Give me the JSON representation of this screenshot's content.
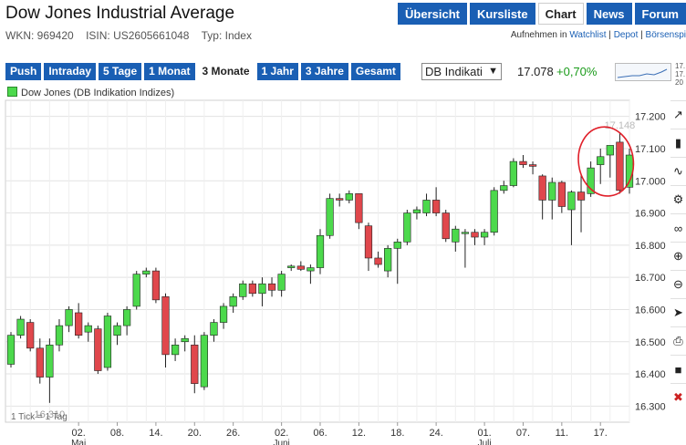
{
  "header": {
    "title": "Dow Jones Industrial Average",
    "wkn": "WKN: 969420",
    "isin": "ISIN: US2605661048",
    "typ": "Typ: Index"
  },
  "nav": {
    "tabs": [
      "Übersicht",
      "Kursliste",
      "Chart",
      "News",
      "Forum"
    ],
    "active": "Chart"
  },
  "links": {
    "prefix": "Aufnehmen in",
    "watchlist": "Watchlist",
    "sep1": " | ",
    "depot": "Depot",
    "sep2": " | ",
    "boersenspiel": "Börsenspi"
  },
  "ranges": {
    "items": [
      "Push",
      "Intraday",
      "5 Tage",
      "1 Monat",
      "3 Monate",
      "1 Jahr",
      "3 Jahre",
      "Gesamt"
    ],
    "active": "3 Monate"
  },
  "exchange": {
    "selected": "DB Indikati"
  },
  "quote": {
    "price": "17.078",
    "change": "+0,70%"
  },
  "minichart": {
    "labels": [
      "17.",
      "17.",
      "20"
    ]
  },
  "tools": [
    "trend-tool-icon",
    "bars-tool-icon",
    "wave-tool-icon",
    "settings-icon",
    "link-icon",
    "zoom-in-icon",
    "zoom-out-icon",
    "cursor-icon",
    "print-icon",
    "save-icon",
    "delete-icon"
  ],
  "chart_data": {
    "type": "candlestick",
    "legend": "Dow Jones (DB Indikation Indizes)",
    "tick_note": "1 Tick = 1 Tag",
    "ylim": [
      16250,
      17250
    ],
    "y_ticks": [
      "17.200",
      "17.100",
      "17.000",
      "16.900",
      "16.800",
      "16.700",
      "16.600",
      "16.500",
      "16.400",
      "16.300"
    ],
    "x_ticks": [
      "02.",
      "08.",
      "14.",
      "20.",
      "26.",
      "02.",
      "06.",
      "12.",
      "18.",
      "24.",
      "01.",
      "07.",
      "11.",
      "17."
    ],
    "x_tick_index": [
      7,
      11,
      15,
      19,
      23,
      28,
      32,
      36,
      40,
      44,
      49,
      53,
      57,
      61
    ],
    "months": [
      {
        "label": "Mai",
        "index": 7
      },
      {
        "label": "Juni",
        "index": 28
      },
      {
        "label": "Juli",
        "index": 49
      }
    ],
    "annotations": {
      "low": "16.310",
      "high": "17.148"
    },
    "candles": [
      [
        16430,
        16530,
        16420,
        16520
      ],
      [
        16520,
        16580,
        16510,
        16570
      ],
      [
        16560,
        16570,
        16470,
        16480
      ],
      [
        16480,
        16510,
        16370,
        16390
      ],
      [
        16390,
        16510,
        16310,
        16490
      ],
      [
        16490,
        16570,
        16470,
        16550
      ],
      [
        16550,
        16610,
        16530,
        16600
      ],
      [
        16590,
        16620,
        16510,
        16520
      ],
      [
        16530,
        16560,
        16500,
        16550
      ],
      [
        16540,
        16550,
        16400,
        16410
      ],
      [
        16420,
        16590,
        16410,
        16580
      ],
      [
        16520,
        16560,
        16490,
        16550
      ],
      [
        16550,
        16610,
        16520,
        16600
      ],
      [
        16610,
        16720,
        16600,
        16710
      ],
      [
        16710,
        16730,
        16700,
        16720
      ],
      [
        16720,
        16730,
        16620,
        16630
      ],
      [
        16640,
        16650,
        16420,
        16460
      ],
      [
        16460,
        16510,
        16440,
        16490
      ],
      [
        16500,
        16520,
        16470,
        16510
      ],
      [
        16490,
        16520,
        16340,
        16370
      ],
      [
        16360,
        16530,
        16350,
        16520
      ],
      [
        16520,
        16570,
        16500,
        16560
      ],
      [
        16560,
        16620,
        16540,
        16610
      ],
      [
        16610,
        16650,
        16590,
        16640
      ],
      [
        16640,
        16690,
        16630,
        16680
      ],
      [
        16680,
        16690,
        16640,
        16650
      ],
      [
        16650,
        16700,
        16610,
        16680
      ],
      [
        16680,
        16700,
        16640,
        16660
      ],
      [
        16660,
        16720,
        16640,
        16710
      ],
      [
        16730,
        16740,
        16720,
        16735
      ],
      [
        16735,
        16750,
        16720,
        16725
      ],
      [
        16720,
        16740,
        16680,
        16730
      ],
      [
        16730,
        16850,
        16710,
        16830
      ],
      [
        16830,
        16960,
        16820,
        16945
      ],
      [
        16945,
        16960,
        16920,
        16940
      ],
      [
        16940,
        16970,
        16930,
        16960
      ],
      [
        16960,
        16960,
        16850,
        16870
      ],
      [
        16860,
        16870,
        16720,
        16760
      ],
      [
        16760,
        16780,
        16730,
        16740
      ],
      [
        16720,
        16800,
        16700,
        16790
      ],
      [
        16790,
        16820,
        16680,
        16810
      ],
      [
        16810,
        16910,
        16800,
        16900
      ],
      [
        16900,
        16920,
        16880,
        16910
      ],
      [
        16900,
        16960,
        16890,
        16940
      ],
      [
        16940,
        16980,
        16890,
        16900
      ],
      [
        16900,
        16910,
        16810,
        16820
      ],
      [
        16810,
        16860,
        16780,
        16850
      ],
      [
        16840,
        16850,
        16730,
        16840
      ],
      [
        16840,
        16850,
        16800,
        16825
      ],
      [
        16825,
        16850,
        16800,
        16840
      ],
      [
        16840,
        16980,
        16830,
        16970
      ],
      [
        16970,
        17000,
        16960,
        16985
      ],
      [
        16985,
        17070,
        16980,
        17060
      ],
      [
        17060,
        17080,
        17040,
        17050
      ],
      [
        17050,
        17060,
        17020,
        17045
      ],
      [
        17015,
        17020,
        16880,
        16940
      ],
      [
        16940,
        17010,
        16880,
        16995
      ],
      [
        16995,
        17000,
        16900,
        16920
      ],
      [
        16910,
        16970,
        16800,
        16965
      ],
      [
        16965,
        17020,
        16840,
        16940
      ],
      [
        16960,
        17060,
        16950,
        17040
      ],
      [
        17050,
        17100,
        16990,
        17075
      ],
      [
        17080,
        17110,
        17010,
        17110
      ],
      [
        17120,
        17148,
        16960,
        16970
      ],
      [
        16980,
        17100,
        16960,
        17080
      ]
    ]
  }
}
